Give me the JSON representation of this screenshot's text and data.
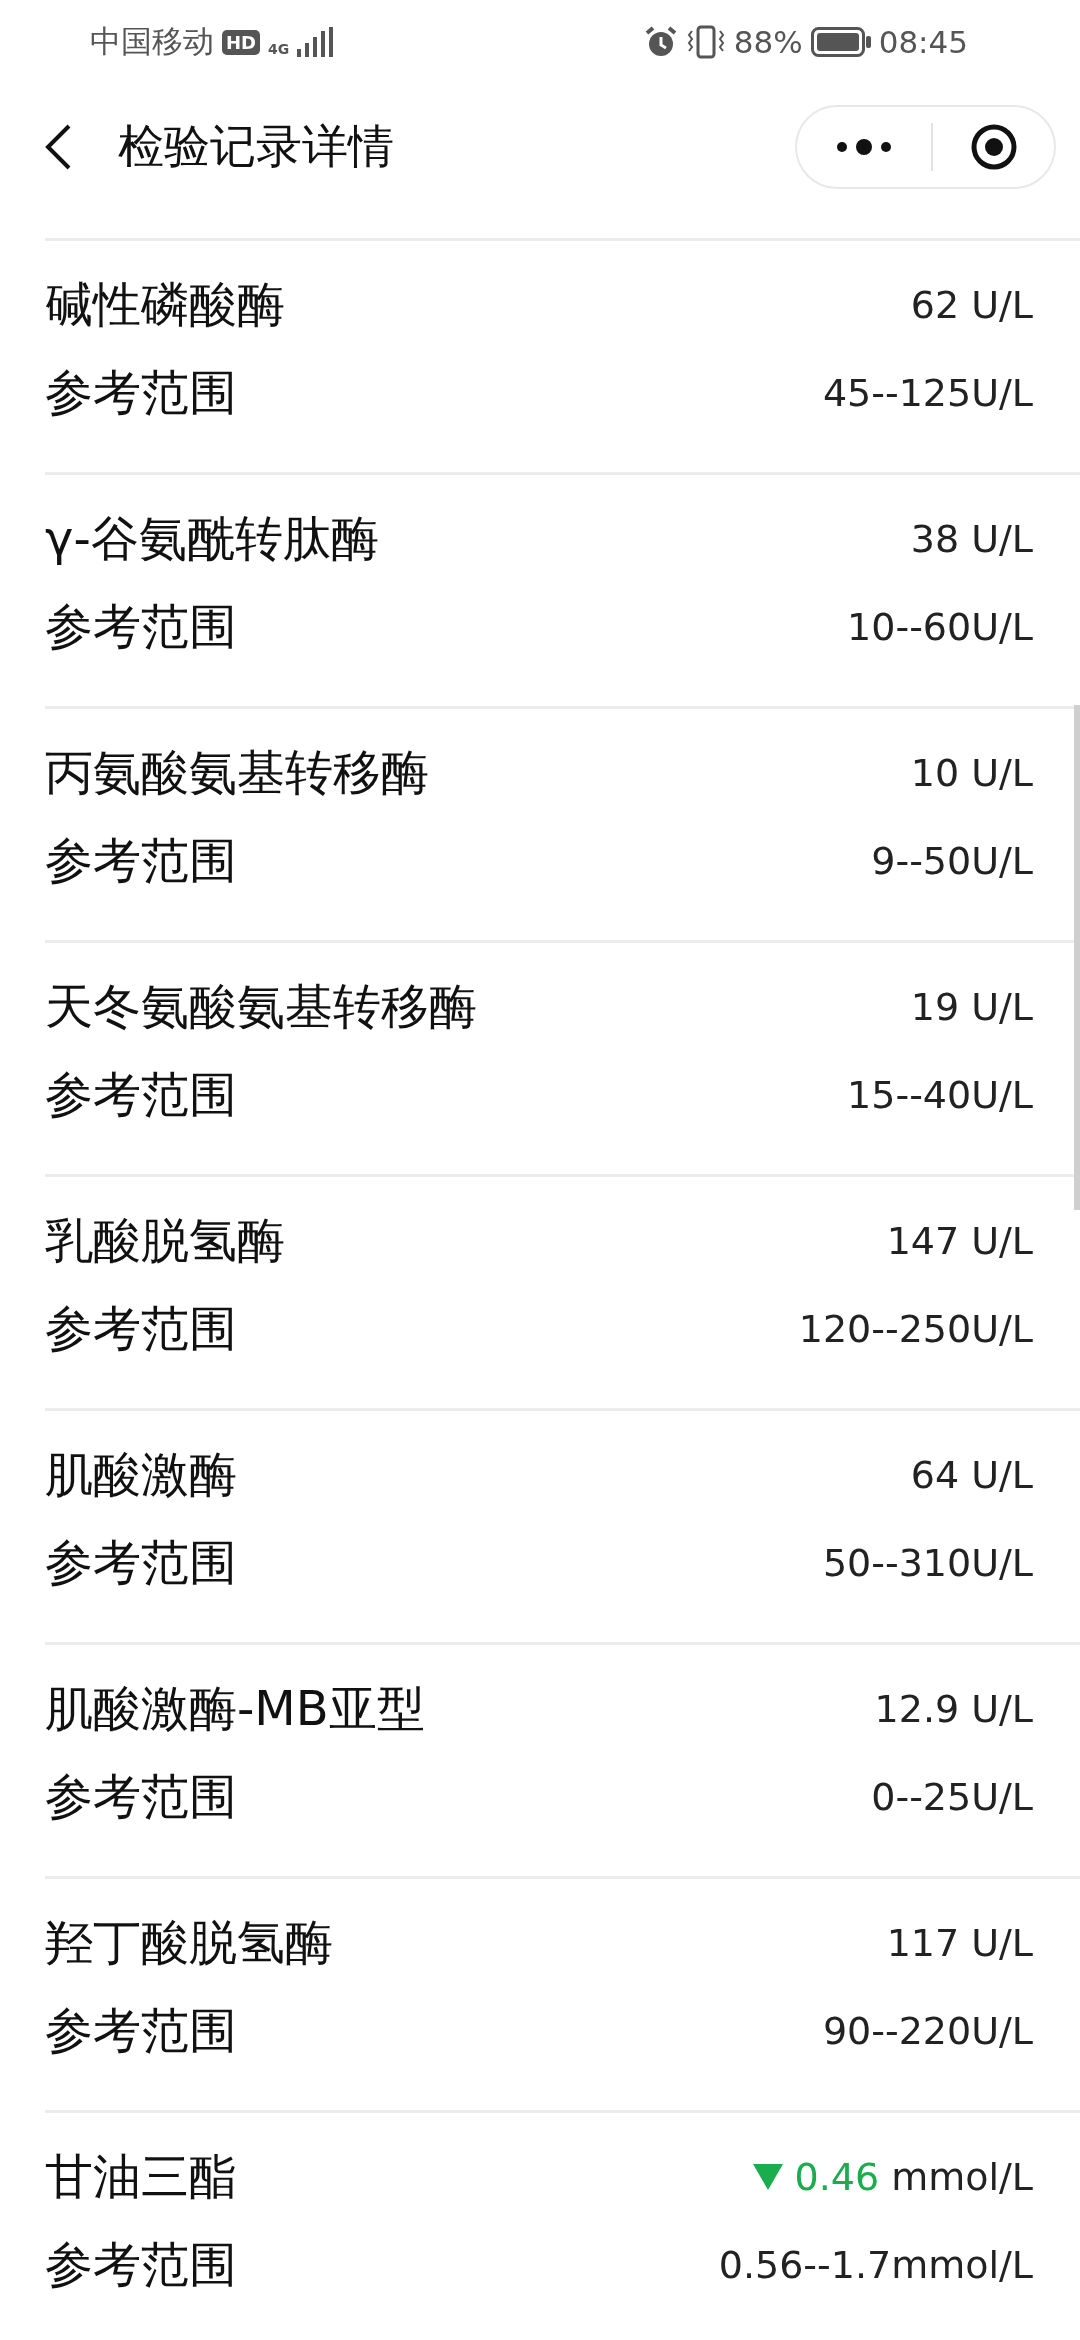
{
  "status_bar": {
    "carrier": "中国移动",
    "hd": "HD",
    "network": "4G",
    "battery": "88%",
    "time": "08:45"
  },
  "header": {
    "title": "检验记录详情"
  },
  "items": [
    {
      "name": "碱性磷酸酶",
      "value": "62",
      "unit": "U/L",
      "low": false,
      "range_label": "参考范围",
      "range": "45--125U/L"
    },
    {
      "name": "γ-谷氨酰转肽酶",
      "value": "38",
      "unit": "U/L",
      "low": false,
      "range_label": "参考范围",
      "range": "10--60U/L"
    },
    {
      "name": "丙氨酸氨基转移酶",
      "value": "10",
      "unit": "U/L",
      "low": false,
      "range_label": "参考范围",
      "range": "9--50U/L"
    },
    {
      "name": "天冬氨酸氨基转移酶",
      "value": "19",
      "unit": "U/L",
      "low": false,
      "range_label": "参考范围",
      "range": "15--40U/L"
    },
    {
      "name": "乳酸脱氢酶",
      "value": "147",
      "unit": "U/L",
      "low": false,
      "range_label": "参考范围",
      "range": "120--250U/L"
    },
    {
      "name": "肌酸激酶",
      "value": "64",
      "unit": "U/L",
      "low": false,
      "range_label": "参考范围",
      "range": "50--310U/L"
    },
    {
      "name": "肌酸激酶-MB亚型",
      "value": "12.9",
      "unit": "U/L",
      "low": false,
      "range_label": "参考范围",
      "range": "0--25U/L"
    },
    {
      "name": "羟丁酸脱氢酶",
      "value": "117",
      "unit": "U/L",
      "low": false,
      "range_label": "参考范围",
      "range": "90--220U/L"
    },
    {
      "name": "甘油三酯",
      "value": "0.46",
      "unit": "mmol/L",
      "low": true,
      "range_label": "参考范围",
      "range": "0.56--1.7mmol/L"
    }
  ]
}
